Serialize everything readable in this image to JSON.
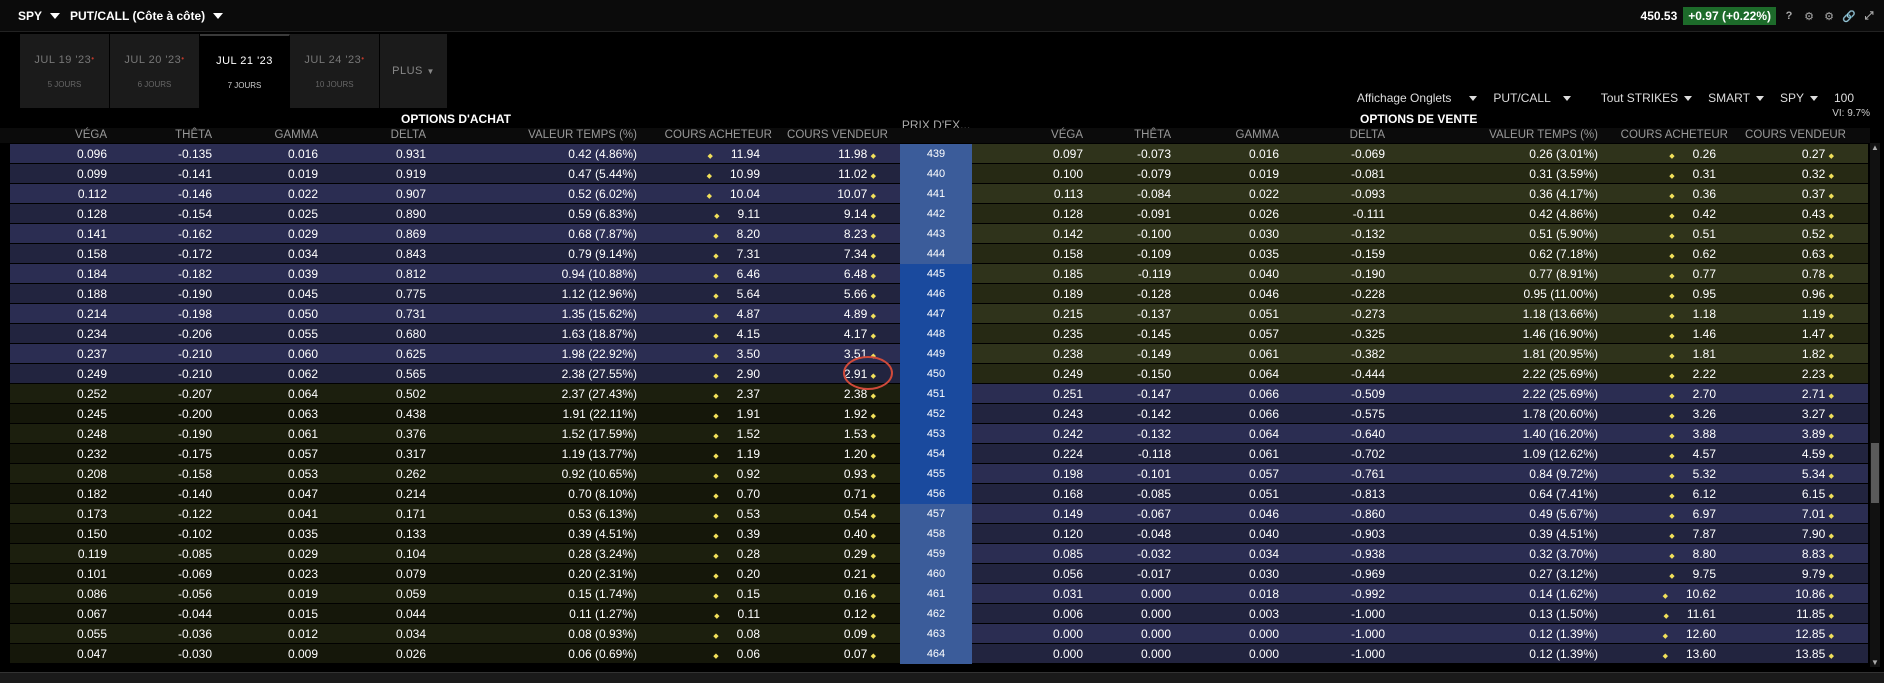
{
  "window": {
    "symbol": "SPY",
    "view": "PUT/CALL (Côte à côte)",
    "last": "450.53",
    "change": "+0.97",
    "change_pct": "(+0.22%)"
  },
  "expiry_tabs": [
    {
      "date": "JUL 19 '23",
      "days": "5 JOURS",
      "active": false
    },
    {
      "date": "JUL 20 '23",
      "days": "6 JOURS",
      "active": false
    },
    {
      "date": "JUL 21 '23",
      "days": "7 JOURS",
      "active": true
    },
    {
      "date": "JUL 24 '23",
      "days": "10 JOURS",
      "active": false
    }
  ],
  "more_label": "PLUS",
  "toolbar": {
    "display": "Affichage Onglets",
    "putcall": "PUT/CALL",
    "strikes": "Tout STRIKES",
    "exchange": "SMART",
    "underlying": "SPY",
    "size": "100"
  },
  "vi": "VI: 9.7%",
  "sections": {
    "calls": "OPTIONS D'ACHAT",
    "puts": "OPTIONS DE VENTE",
    "strike": "PRIX D'EX..."
  },
  "columns": {
    "vega": "VÉGA",
    "theta": "THÊTA",
    "gamma": "GAMMA",
    "delta": "DELTA",
    "time_value": "VALEUR TEMPS (%)",
    "bid": "COURS ACHETEUR",
    "ask": "COURS VENDEUR"
  },
  "rows": [
    {
      "strike": "439",
      "c": [
        "0.096",
        "-0.135",
        "0.016",
        "0.931",
        "0.42 (4.86%)",
        "11.94",
        "11.98"
      ],
      "p": [
        "0.097",
        "-0.073",
        "0.016",
        "-0.069",
        "0.26 (3.01%)",
        "0.26",
        "0.27"
      ]
    },
    {
      "strike": "440",
      "c": [
        "0.099",
        "-0.141",
        "0.019",
        "0.919",
        "0.47 (5.44%)",
        "10.99",
        "11.02"
      ],
      "p": [
        "0.100",
        "-0.079",
        "0.019",
        "-0.081",
        "0.31 (3.59%)",
        "0.31",
        "0.32"
      ]
    },
    {
      "strike": "441",
      "c": [
        "0.112",
        "-0.146",
        "0.022",
        "0.907",
        "0.52 (6.02%)",
        "10.04",
        "10.07"
      ],
      "p": [
        "0.113",
        "-0.084",
        "0.022",
        "-0.093",
        "0.36 (4.17%)",
        "0.36",
        "0.37"
      ]
    },
    {
      "strike": "442",
      "c": [
        "0.128",
        "-0.154",
        "0.025",
        "0.890",
        "0.59 (6.83%)",
        "9.11",
        "9.14"
      ],
      "p": [
        "0.128",
        "-0.091",
        "0.026",
        "-0.111",
        "0.42 (4.86%)",
        "0.42",
        "0.43"
      ]
    },
    {
      "strike": "443",
      "c": [
        "0.141",
        "-0.162",
        "0.029",
        "0.869",
        "0.68 (7.87%)",
        "8.20",
        "8.23"
      ],
      "p": [
        "0.142",
        "-0.100",
        "0.030",
        "-0.132",
        "0.51 (5.90%)",
        "0.51",
        "0.52"
      ]
    },
    {
      "strike": "444",
      "c": [
        "0.158",
        "-0.172",
        "0.034",
        "0.843",
        "0.79 (9.14%)",
        "7.31",
        "7.34"
      ],
      "p": [
        "0.158",
        "-0.109",
        "0.035",
        "-0.159",
        "0.62 (7.18%)",
        "0.62",
        "0.63"
      ]
    },
    {
      "strike": "445",
      "c": [
        "0.184",
        "-0.182",
        "0.039",
        "0.812",
        "0.94 (10.88%)",
        "6.46",
        "6.48"
      ],
      "p": [
        "0.185",
        "-0.119",
        "0.040",
        "-0.190",
        "0.77 (8.91%)",
        "0.77",
        "0.78"
      ]
    },
    {
      "strike": "446",
      "c": [
        "0.188",
        "-0.190",
        "0.045",
        "0.775",
        "1.12 (12.96%)",
        "5.64",
        "5.66"
      ],
      "p": [
        "0.189",
        "-0.128",
        "0.046",
        "-0.228",
        "0.95 (11.00%)",
        "0.95",
        "0.96"
      ]
    },
    {
      "strike": "447",
      "c": [
        "0.214",
        "-0.198",
        "0.050",
        "0.731",
        "1.35 (15.62%)",
        "4.87",
        "4.89"
      ],
      "p": [
        "0.215",
        "-0.137",
        "0.051",
        "-0.273",
        "1.18 (13.66%)",
        "1.18",
        "1.19"
      ]
    },
    {
      "strike": "448",
      "c": [
        "0.234",
        "-0.206",
        "0.055",
        "0.680",
        "1.63 (18.87%)",
        "4.15",
        "4.17"
      ],
      "p": [
        "0.235",
        "-0.145",
        "0.057",
        "-0.325",
        "1.46 (16.90%)",
        "1.46",
        "1.47"
      ]
    },
    {
      "strike": "449",
      "c": [
        "0.237",
        "-0.210",
        "0.060",
        "0.625",
        "1.98 (22.92%)",
        "3.50",
        "3.51"
      ],
      "p": [
        "0.238",
        "-0.149",
        "0.061",
        "-0.382",
        "1.81 (20.95%)",
        "1.81",
        "1.82"
      ]
    },
    {
      "strike": "450",
      "c": [
        "0.249",
        "-0.210",
        "0.062",
        "0.565",
        "2.38 (27.55%)",
        "2.90",
        "2.91"
      ],
      "p": [
        "0.249",
        "-0.150",
        "0.064",
        "-0.444",
        "2.22 (25.69%)",
        "2.22",
        "2.23"
      ]
    },
    {
      "strike": "451",
      "c": [
        "0.252",
        "-0.207",
        "0.064",
        "0.502",
        "2.37 (27.43%)",
        "2.37",
        "2.38"
      ],
      "p": [
        "0.251",
        "-0.147",
        "0.066",
        "-0.509",
        "2.22 (25.69%)",
        "2.70",
        "2.71"
      ]
    },
    {
      "strike": "452",
      "c": [
        "0.245",
        "-0.200",
        "0.063",
        "0.438",
        "1.91 (22.11%)",
        "1.91",
        "1.92"
      ],
      "p": [
        "0.243",
        "-0.142",
        "0.066",
        "-0.575",
        "1.78 (20.60%)",
        "3.26",
        "3.27"
      ]
    },
    {
      "strike": "453",
      "c": [
        "0.248",
        "-0.190",
        "0.061",
        "0.376",
        "1.52 (17.59%)",
        "1.52",
        "1.53"
      ],
      "p": [
        "0.242",
        "-0.132",
        "0.064",
        "-0.640",
        "1.40 (16.20%)",
        "3.88",
        "3.89"
      ]
    },
    {
      "strike": "454",
      "c": [
        "0.232",
        "-0.175",
        "0.057",
        "0.317",
        "1.19 (13.77%)",
        "1.19",
        "1.20"
      ],
      "p": [
        "0.224",
        "-0.118",
        "0.061",
        "-0.702",
        "1.09 (12.62%)",
        "4.57",
        "4.59"
      ]
    },
    {
      "strike": "455",
      "c": [
        "0.208",
        "-0.158",
        "0.053",
        "0.262",
        "0.92 (10.65%)",
        "0.92",
        "0.93"
      ],
      "p": [
        "0.198",
        "-0.101",
        "0.057",
        "-0.761",
        "0.84 (9.72%)",
        "5.32",
        "5.34"
      ]
    },
    {
      "strike": "456",
      "c": [
        "0.182",
        "-0.140",
        "0.047",
        "0.214",
        "0.70 (8.10%)",
        "0.70",
        "0.71"
      ],
      "p": [
        "0.168",
        "-0.085",
        "0.051",
        "-0.813",
        "0.64 (7.41%)",
        "6.12",
        "6.15"
      ]
    },
    {
      "strike": "457",
      "c": [
        "0.173",
        "-0.122",
        "0.041",
        "0.171",
        "0.53 (6.13%)",
        "0.53",
        "0.54"
      ],
      "p": [
        "0.149",
        "-0.067",
        "0.046",
        "-0.860",
        "0.49 (5.67%)",
        "6.97",
        "7.01"
      ]
    },
    {
      "strike": "458",
      "c": [
        "0.150",
        "-0.102",
        "0.035",
        "0.133",
        "0.39 (4.51%)",
        "0.39",
        "0.40"
      ],
      "p": [
        "0.120",
        "-0.048",
        "0.040",
        "-0.903",
        "0.39 (4.51%)",
        "7.87",
        "7.90"
      ]
    },
    {
      "strike": "459",
      "c": [
        "0.119",
        "-0.085",
        "0.029",
        "0.104",
        "0.28 (3.24%)",
        "0.28",
        "0.29"
      ],
      "p": [
        "0.085",
        "-0.032",
        "0.034",
        "-0.938",
        "0.32 (3.70%)",
        "8.80",
        "8.83"
      ]
    },
    {
      "strike": "460",
      "c": [
        "0.101",
        "-0.069",
        "0.023",
        "0.079",
        "0.20 (2.31%)",
        "0.20",
        "0.21"
      ],
      "p": [
        "0.056",
        "-0.017",
        "0.030",
        "-0.969",
        "0.27 (3.12%)",
        "9.75",
        "9.79"
      ]
    },
    {
      "strike": "461",
      "c": [
        "0.086",
        "-0.056",
        "0.019",
        "0.059",
        "0.15 (1.74%)",
        "0.15",
        "0.16"
      ],
      "p": [
        "0.031",
        "0.000",
        "0.018",
        "-0.992",
        "0.14 (1.62%)",
        "10.62",
        "10.86"
      ]
    },
    {
      "strike": "462",
      "c": [
        "0.067",
        "-0.044",
        "0.015",
        "0.044",
        "0.11 (1.27%)",
        "0.11",
        "0.12"
      ],
      "p": [
        "0.006",
        "0.000",
        "0.003",
        "-1.000",
        "0.13 (1.50%)",
        "11.61",
        "11.85"
      ]
    },
    {
      "strike": "463",
      "c": [
        "0.055",
        "-0.036",
        "0.012",
        "0.034",
        "0.08 (0.93%)",
        "0.08",
        "0.09"
      ],
      "p": [
        "0.000",
        "0.000",
        "0.000",
        "-1.000",
        "0.12 (1.39%)",
        "12.60",
        "12.85"
      ]
    },
    {
      "strike": "464",
      "c": [
        "0.047",
        "-0.030",
        "0.009",
        "0.026",
        "0.06 (0.69%)",
        "0.06",
        "0.07"
      ],
      "p": [
        "0.000",
        "0.000",
        "0.000",
        "-1.000",
        "0.12 (1.39%)",
        "13.60",
        "13.85"
      ]
    }
  ],
  "atm_strike": "450",
  "colors": {
    "call_itm_a": "#2b2d52",
    "call_itm_b": "#22243f",
    "call_otm_a": "#1c1f0e",
    "call_otm_b": "#15170a",
    "put_itm_a": "#2b2d52",
    "put_itm_b": "#22243f",
    "put_otm_a": "#2f331b",
    "put_otm_b": "#262914",
    "strike_light": "#3b5c9a",
    "strike_dark": "#1a4a9e",
    "positive": "#1d6b2a",
    "highlight_circle": "#d04a3a"
  }
}
